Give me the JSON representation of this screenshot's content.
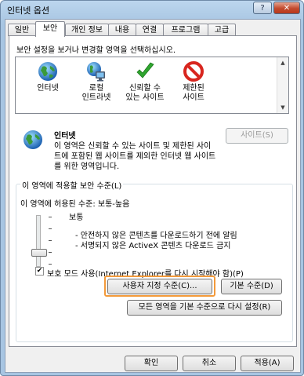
{
  "window": {
    "title": "인터넷 옵션",
    "help_label": "?",
    "close_label": "✕"
  },
  "tabs": [
    {
      "label": "일반"
    },
    {
      "label": "보안"
    },
    {
      "label": "개인 정보"
    },
    {
      "label": "내용"
    },
    {
      "label": "연결"
    },
    {
      "label": "프로그램"
    },
    {
      "label": "고급"
    }
  ],
  "zones": {
    "instruction": "보안 설정을 보거나 변경할 영역을 선택하십시오.",
    "items": [
      {
        "label": "인터넷",
        "icon": "globe-icon"
      },
      {
        "label": "로컬\n인트라넷",
        "icon": "intranet-icon"
      },
      {
        "label": "신뢰할 수\n있는 사이트",
        "icon": "checkmark-icon"
      },
      {
        "label": "제한된\n사이트",
        "icon": "restricted-icon"
      }
    ]
  },
  "selected_zone": {
    "name": "인터넷",
    "description": "이 영역은 신뢰할 수 있는 사이트 및 제한된 사이\n트에 포함된 웹 사이트를 제외한 인터넷 웹 사이트\n를 위한 영역입니다.",
    "sites_button": "사이트(S)"
  },
  "security_level": {
    "group_title": "이 영역에 적용할 보안 수준(L)",
    "allowed_levels": "이 영역에 허용된 수준: 보통-높음",
    "level_name": "보통",
    "bullets": [
      "- 안전하지 않은 콘텐츠를 다운로드하기 전에 알림",
      "- 서명되지 않은 ActiveX 콘텐츠 다운로드 금지"
    ],
    "protected_mode_label": "보호 모드 사용(Internet Explorer를 다시 시작해야 함)(P)",
    "protected_mode_checked": true,
    "custom_level_button": "사용자 지정 수준(C)...",
    "default_level_button": "기본 수준(D)",
    "reset_all_button": "모든 영역을 기본 수준으로 다시 설정(R)"
  },
  "footer": {
    "ok": "확인",
    "cancel": "취소",
    "apply": "적용(A)"
  },
  "colors": {
    "highlight": "#f39a3a",
    "title_bar": "#a7c5e2",
    "close_button": "#c24a2d"
  }
}
